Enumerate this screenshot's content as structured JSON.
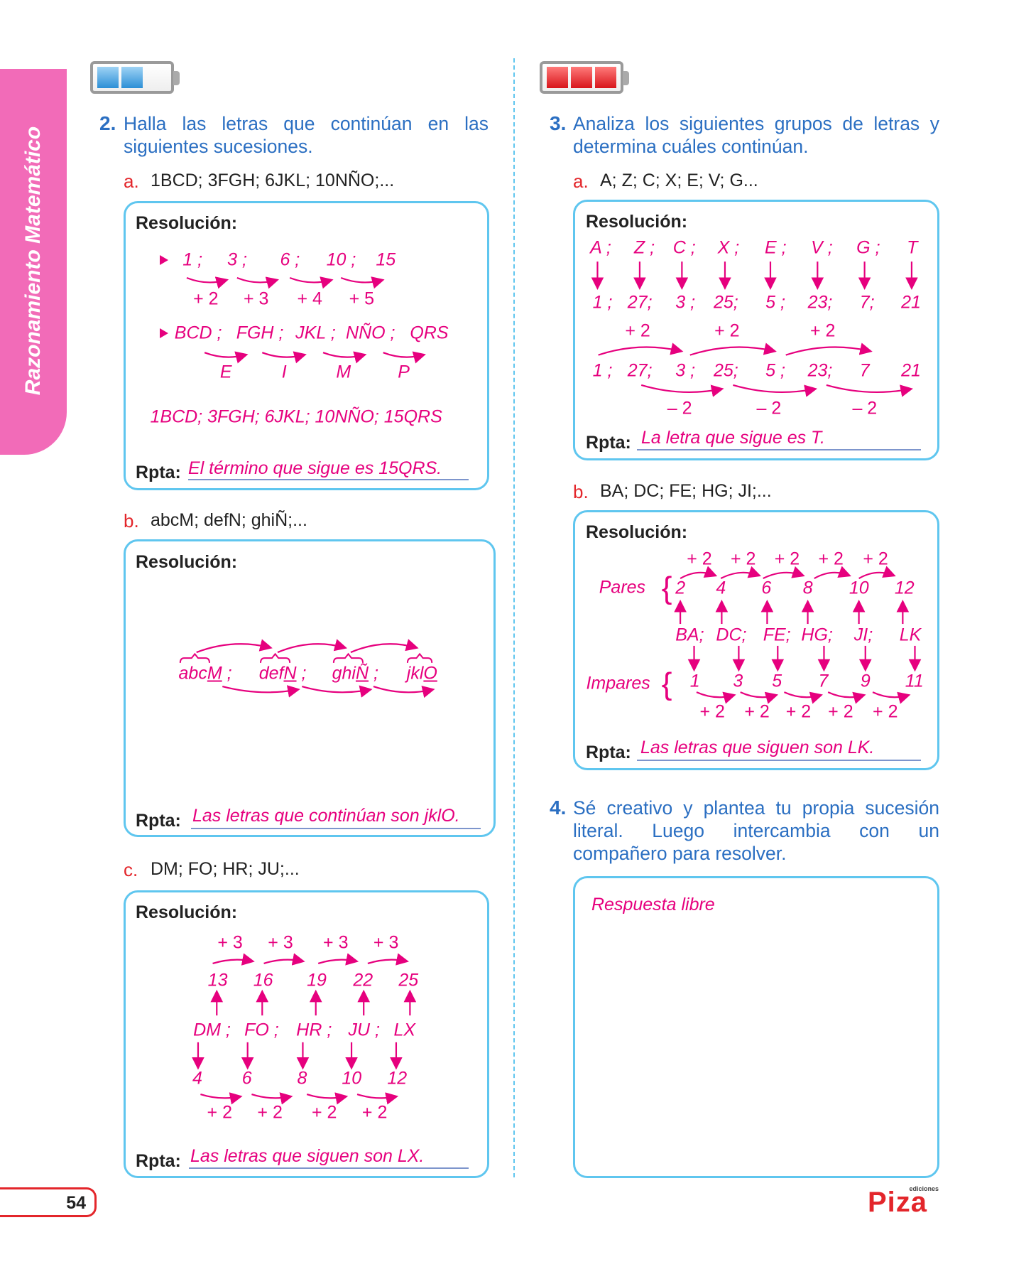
{
  "sidebar_tab": "Razonamiento Matemático",
  "page_number": "54",
  "logo": {
    "brand": "Piza",
    "small": "ediciones"
  },
  "colors": {
    "pink": "#e6007e",
    "blue": "#2b6fc2",
    "red": "#e3262b",
    "box_border": "#5fc6ef",
    "tab": "#f26bb8"
  },
  "batteries": {
    "left_level": "2/3",
    "right_level": "3/3"
  },
  "q2": {
    "number": "2.",
    "text": "Halla las letras que continúan en las siguientes sucesiones.",
    "a": {
      "letter": "a.",
      "sequence": "1BCD; 3FGH; 6JKL; 10NÑO;...",
      "resolution_label": "Resolución:",
      "row1": [
        "1 ;",
        "3 ;",
        "6 ;",
        "10 ;",
        "15"
      ],
      "row1_diffs": [
        "+ 2",
        "+ 3",
        "+ 4",
        "+ 5"
      ],
      "row2": [
        "BCD ;",
        "FGH ;",
        "JKL ;",
        "NÑO ;",
        "QRS"
      ],
      "row2_gaps": [
        "E",
        "I",
        "M",
        "P"
      ],
      "result": "1BCD; 3FGH; 6JKL; 10NÑO; 15QRS",
      "rpta_label": "Rpta:",
      "answer": "El término que sigue es 15QRS."
    },
    "b": {
      "letter": "b.",
      "sequence": "abcM; defN; ghiÑ;...",
      "resolution_label": "Resolución:",
      "terms": [
        {
          "prefix": "abc",
          "key": "M",
          "sep": " ;"
        },
        {
          "prefix": "def",
          "key": "N",
          "sep": " ;"
        },
        {
          "prefix": "ghi",
          "key": "Ñ",
          "sep": " ;"
        },
        {
          "prefix": "jkl",
          "key": "O",
          "sep": ""
        }
      ],
      "rpta_label": "Rpta:",
      "answer": "Las letras que continúan son jklO."
    },
    "c": {
      "letter": "c.",
      "sequence": "DM; FO; HR; JU;...",
      "resolution_label": "Resolución:",
      "top_diffs": [
        "+ 3",
        "+ 3",
        "+ 3",
        "+ 3"
      ],
      "top_numbers": [
        "13",
        "16",
        "19",
        "22",
        "25"
      ],
      "letters": [
        "DM ;",
        "FO ;",
        "HR ;",
        "JU ;",
        "LX"
      ],
      "bottom_numbers": [
        "4",
        "6",
        "8",
        "10",
        "12"
      ],
      "bottom_diffs": [
        "+ 2",
        "+ 2",
        "+ 2",
        "+ 2"
      ],
      "rpta_label": "Rpta:",
      "answer": "Las letras que siguen son LX."
    }
  },
  "q3": {
    "number": "3.",
    "text": "Analiza los siguientes grupos de letras y determina cuáles continúan.",
    "a": {
      "letter": "a.",
      "sequence": "A; Z; C; X; E; V; G...",
      "resolution_label": "Resolución:",
      "letters": [
        "A ;",
        "Z ;",
        "C ;",
        "X ;",
        "E ;",
        "V ;",
        "G ;",
        "T"
      ],
      "numbers": [
        "1 ;",
        "27;",
        "3 ;",
        "25;",
        "5 ;",
        "23;",
        "7;",
        "21"
      ],
      "top_diffs": [
        "+ 2",
        "+ 2",
        "+ 2"
      ],
      "numbers2": [
        "1 ;",
        "27;",
        "3 ;",
        "25;",
        "5 ;",
        "23;",
        "7",
        "21"
      ],
      "bottom_diffs": [
        "– 2",
        "– 2",
        "– 2"
      ],
      "rpta_label": "Rpta:",
      "answer": "La letra que sigue es T."
    },
    "b": {
      "letter": "b.",
      "sequence": "BA; DC; FE; HG; JI;...",
      "resolution_label": "Resolución:",
      "pares_label": "Pares",
      "pares_diffs": [
        "+ 2",
        "+ 2",
        "+ 2",
        "+ 2",
        "+ 2"
      ],
      "pares": [
        "2",
        "4",
        "6",
        "8",
        "10",
        "12"
      ],
      "letters": [
        "BA;",
        "DC;",
        "FE;",
        "HG;",
        "JI;",
        "LK"
      ],
      "impares_label": "Impares",
      "impares": [
        "1",
        "3",
        "5",
        "7",
        "9",
        "11"
      ],
      "impares_diffs": [
        "+ 2",
        "+ 2",
        "+ 2",
        "+ 2",
        "+ 2"
      ],
      "brace": "{",
      "rpta_label": "Rpta:",
      "answer": "Las letras que siguen son LK."
    }
  },
  "q4": {
    "number": "4.",
    "text": "Sé creativo y plantea tu propia sucesión literal. Luego intercambia con un compañero para resolver.",
    "answer": "Respuesta libre"
  }
}
